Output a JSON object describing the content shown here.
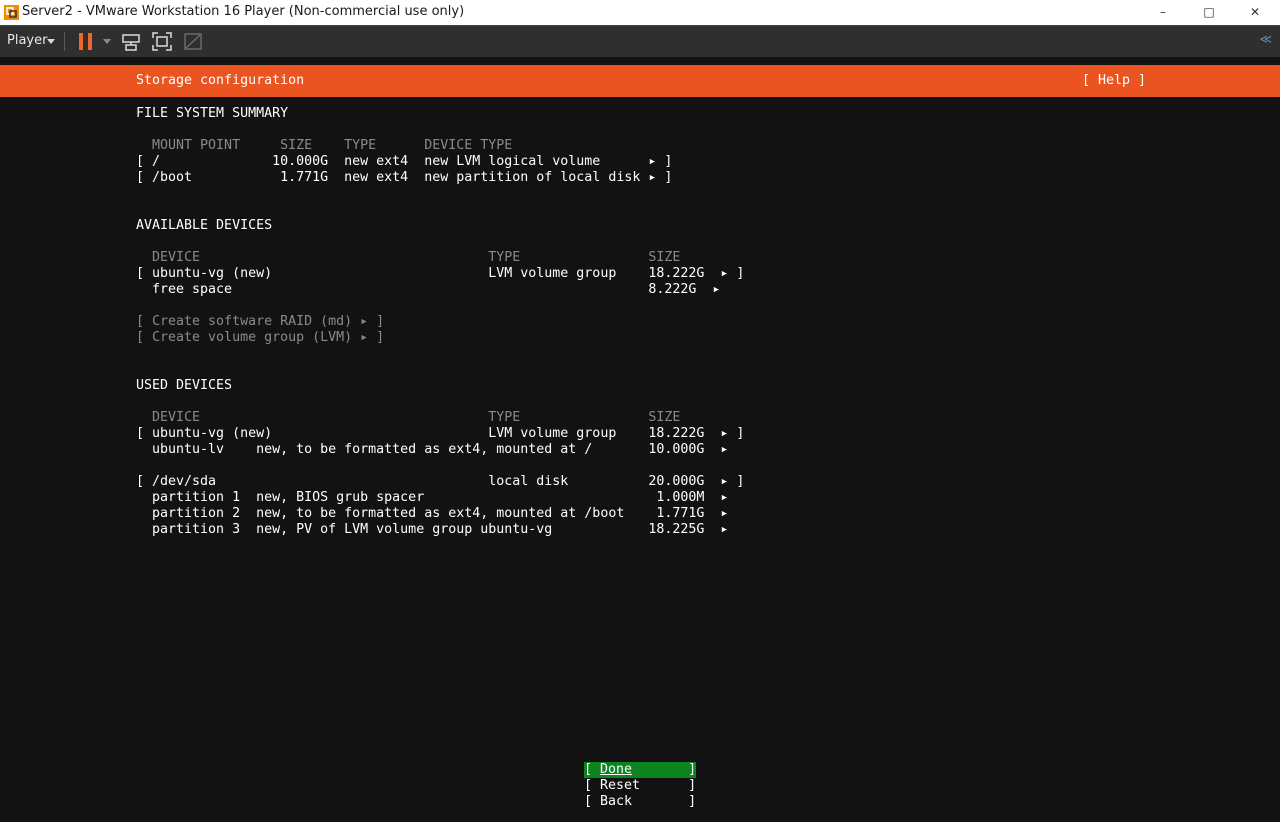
{
  "window": {
    "title": "Server2 - VMware Workstation 16 Player (Non-commercial use only)",
    "minimize_glyph": "–",
    "maximize_glyph": "□",
    "close_glyph": "✕"
  },
  "toolbar": {
    "player_menu": "Player",
    "pause_icon": "pause-icon",
    "send_ctrl_alt_del_icon": "send-keys-icon",
    "fullscreen_icon": "fullscreen-icon",
    "unity_icon": "unity-icon",
    "collapse_glyph": "≪"
  },
  "colors": {
    "header_orange": "#e95420",
    "focus_green": "#0e8420",
    "terminal_bg": "#121212",
    "dim_text": "#8a8a8a",
    "pause_accent": "#f0662a"
  },
  "installer": {
    "header_title": "Storage configuration",
    "help_button": "[ Help ]",
    "fs_summary": {
      "heading": "FILE SYSTEM SUMMARY",
      "columns": "  MOUNT POINT     SIZE    TYPE      DEVICE TYPE",
      "rows": [
        "[ /              10.000G  new ext4  new LVM logical volume      ▸ ]",
        "[ /boot           1.771G  new ext4  new partition of local disk ▸ ]"
      ]
    },
    "available_devices": {
      "heading": "AVAILABLE DEVICES",
      "columns": "  DEVICE                                    TYPE                SIZE",
      "rows": [
        "[ ubuntu-vg (new)                           LVM volume group    18.222G  ▸ ]",
        "  free space                                                    8.222G  ▸"
      ],
      "actions": [
        "[ Create software RAID (md) ▸ ]",
        "[ Create volume group (LVM) ▸ ]"
      ]
    },
    "used_devices": {
      "heading": "USED DEVICES",
      "columns": "  DEVICE                                    TYPE                SIZE",
      "rows": [
        "[ ubuntu-vg (new)                           LVM volume group    18.222G  ▸ ]",
        "  ubuntu-lv    new, to be formatted as ext4, mounted at /       10.000G  ▸",
        "[ /dev/sda                                  local disk          20.000G  ▸ ]",
        "  partition 1  new, BIOS grub spacer                             1.000M  ▸",
        "  partition 2  new, to be formatted as ext4, mounted at /boot    1.771G  ▸",
        "  partition 3  new, PV of LVM volume group ubuntu-vg            18.225G  ▸"
      ]
    },
    "buttons": {
      "done_open": "[ ",
      "done_label": "Done",
      "done_close": "       ]",
      "reset": "[ Reset      ]",
      "back": "[ Back       ]"
    }
  }
}
